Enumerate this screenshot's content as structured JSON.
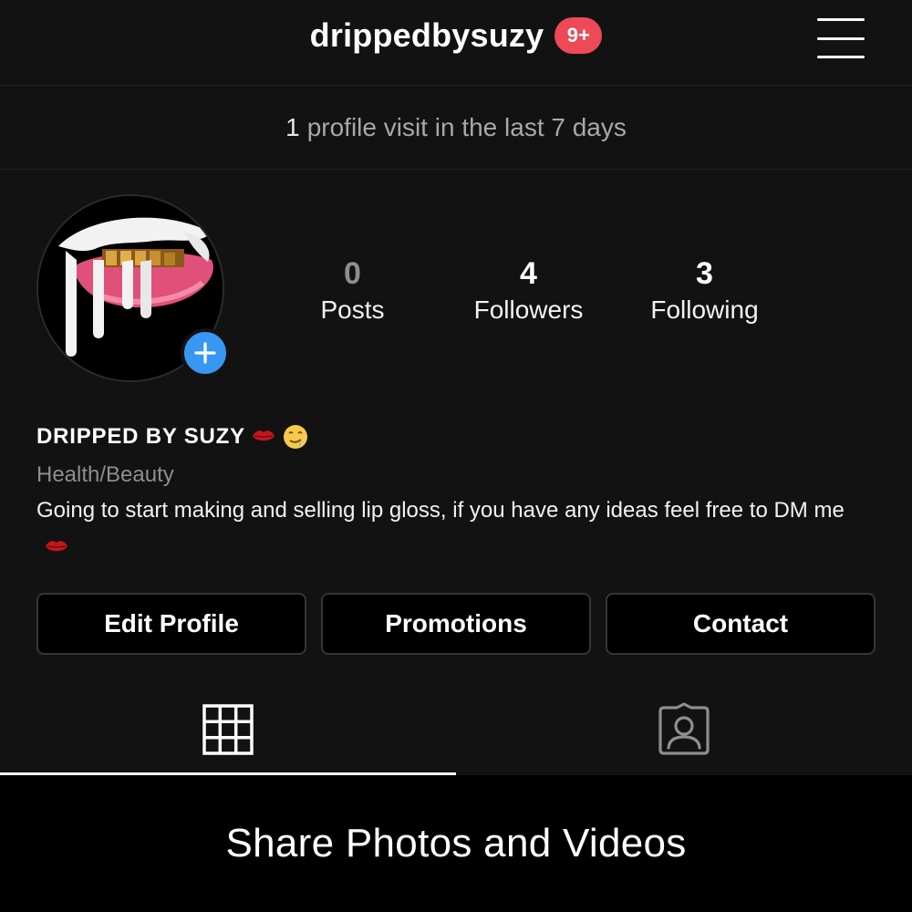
{
  "header": {
    "username": "drippedbysuzy",
    "notification_badge": "9+",
    "badge_color": "#ed4956"
  },
  "insights": {
    "count": "1",
    "text": "profile visit in the last 7 days"
  },
  "profile": {
    "stats": [
      {
        "count": "0",
        "label": "Posts"
      },
      {
        "count": "4",
        "label": "Followers"
      },
      {
        "count": "3",
        "label": "Following"
      }
    ],
    "display_name": "DRIPPED BY SUZY",
    "category": "Health/Beauty",
    "bio": "Going to start making and selling lip gloss, if you have any ideas feel free to DM me"
  },
  "actions": {
    "edit_profile": "Edit Profile",
    "promotions": "Promotions",
    "contact": "Contact"
  },
  "tabs": [
    {
      "icon": "grid-icon",
      "active": true
    },
    {
      "icon": "tagged-photos-icon",
      "active": false
    }
  ],
  "empty_state": {
    "title": "Share Photos and Videos"
  },
  "colors": {
    "background": "#121212",
    "accent_blue": "#3897f0",
    "muted_text": "#8e8e8e"
  }
}
